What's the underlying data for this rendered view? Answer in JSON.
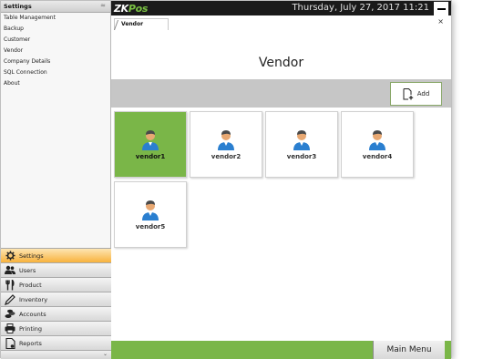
{
  "sidebar": {
    "title": "Settings",
    "pin": "≈",
    "items": [
      "Table Management",
      "Backup",
      "Customer",
      "Vendor",
      "Company Details",
      "SQL Connection",
      "About"
    ],
    "categories": [
      {
        "label": "Settings",
        "icon": "gear-icon",
        "active": true
      },
      {
        "label": "Users",
        "icon": "users-icon"
      },
      {
        "label": "Product",
        "icon": "fork-knife-icon"
      },
      {
        "label": "Inventory",
        "icon": "pencil-icon"
      },
      {
        "label": "Accounts",
        "icon": "coins-icon"
      },
      {
        "label": "Printing",
        "icon": "printer-icon"
      },
      {
        "label": "Reports",
        "icon": "report-icon"
      }
    ],
    "footer": "⌄"
  },
  "header": {
    "logo_zk": "ZK",
    "logo_pos": "Pos",
    "datetime": "Thursday, July 27, 2017 11:21"
  },
  "tab": {
    "label": "Vendor",
    "close": "×"
  },
  "page": {
    "title": "Vendor"
  },
  "toolbar": {
    "add_label": "Add"
  },
  "vendors": [
    {
      "name": "vendor1",
      "selected": true
    },
    {
      "name": "vendor2"
    },
    {
      "name": "vendor3"
    },
    {
      "name": "vendor4"
    },
    {
      "name": "vendor5"
    }
  ],
  "footer": {
    "main_menu": "Main Menu"
  },
  "colors": {
    "accent_green": "#7ab648",
    "active_orange": "#f8b23c",
    "topbar": "#1a1a1a"
  }
}
